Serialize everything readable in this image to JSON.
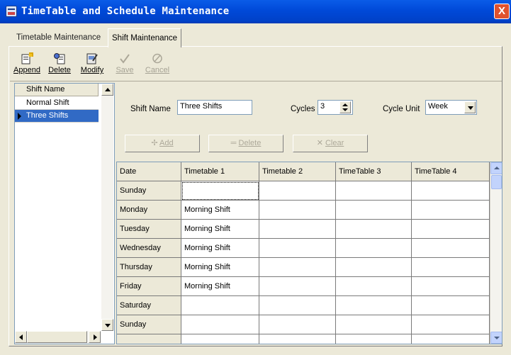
{
  "window": {
    "title": "TimeTable and Schedule Maintenance",
    "close_label": "X"
  },
  "tabs": [
    {
      "label": "Timetable Maintenance",
      "active": false
    },
    {
      "label": "Shift Maintenance",
      "active": true
    }
  ],
  "toolbar": {
    "append": "Append",
    "delete": "Delete",
    "modify": "Modify",
    "save": "Save",
    "cancel": "Cancel"
  },
  "shift_list": {
    "header": "Shift Name",
    "items": [
      "Normal Shift",
      "Three Shifts"
    ],
    "selected_index": 1
  },
  "form": {
    "shift_name_label": "Shift Name",
    "shift_name_value": "Three Shifts",
    "cycles_label": "Cycles",
    "cycles_value": "3",
    "cycle_unit_label": "Cycle Unit",
    "cycle_unit_value": "Week"
  },
  "actions": {
    "add": "Add",
    "delete": "Delete",
    "clear": "Clear"
  },
  "schedule_grid": {
    "headers": [
      "Date",
      "Timetable 1",
      "Timetable 2",
      "TimeTable 3",
      "TimeTable 4"
    ],
    "rows": [
      [
        "Sunday",
        "",
        "",
        "",
        ""
      ],
      [
        "Monday",
        "Morning Shift",
        "",
        "",
        ""
      ],
      [
        "Tuesday",
        "Morning Shift",
        "",
        "",
        ""
      ],
      [
        "Wednesday",
        "Morning Shift",
        "",
        "",
        ""
      ],
      [
        "Thursday",
        "Morning Shift",
        "",
        "",
        ""
      ],
      [
        "Friday",
        "Morning Shift",
        "",
        "",
        ""
      ],
      [
        "Saturday",
        "",
        "",
        "",
        ""
      ],
      [
        "Sunday",
        "",
        "",
        "",
        ""
      ]
    ]
  },
  "colors": {
    "titlebar": "#0049d8",
    "selection": "#316ac5",
    "disabled_text": "#aca899"
  }
}
